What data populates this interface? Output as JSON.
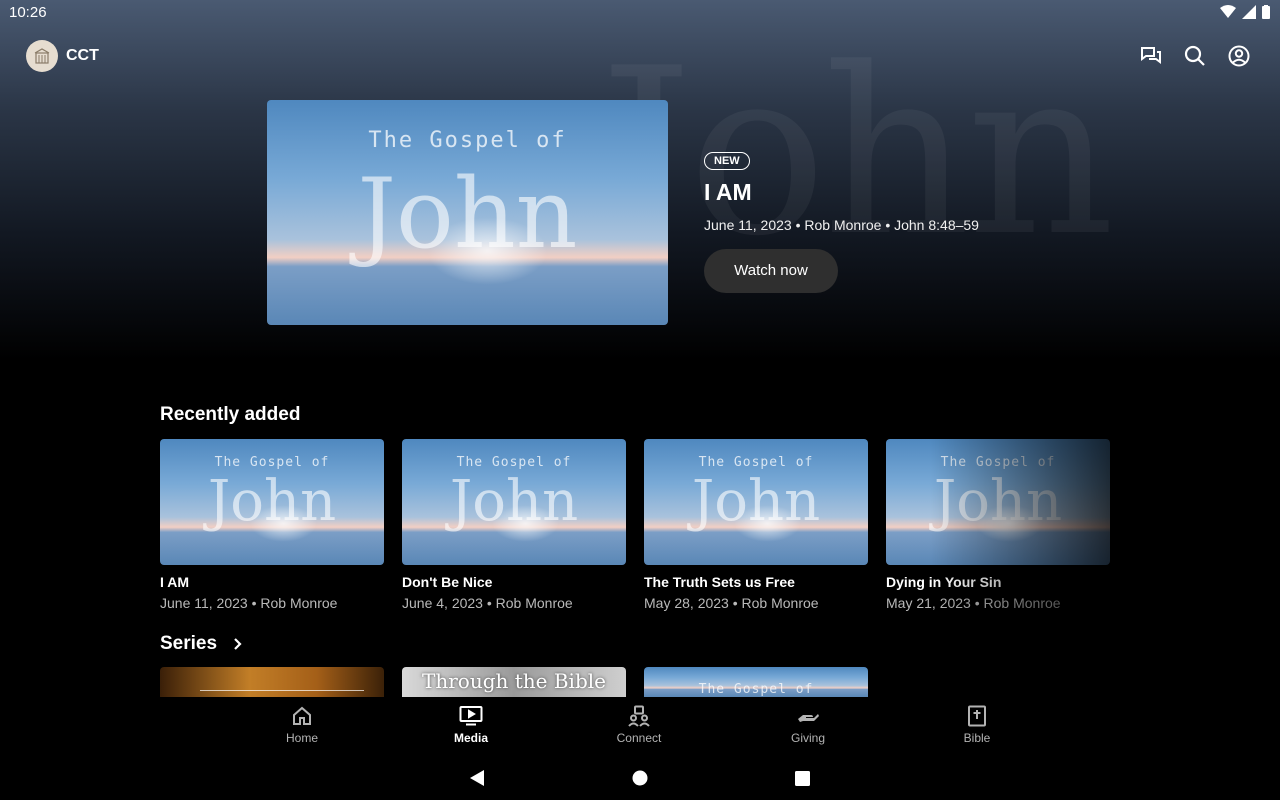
{
  "status": {
    "time": "10:26"
  },
  "app": {
    "name": "CCT"
  },
  "hero": {
    "badge": "NEW",
    "title": "I AM",
    "meta": "June 11, 2023 • Rob Monroe • John 8:48–59",
    "watch_label": "Watch now",
    "art_line1": "The Gospel of",
    "art_line2": "John"
  },
  "recent": {
    "title": "Recently added",
    "items": [
      {
        "title": "I AM",
        "meta": "June 11, 2023 • Rob Monroe",
        "art_line1": "The Gospel of",
        "art_line2": "John"
      },
      {
        "title": "Don't Be Nice",
        "meta": "June 4, 2023 • Rob Monroe",
        "art_line1": "The Gospel of",
        "art_line2": "John"
      },
      {
        "title": "The Truth Sets us Free",
        "meta": "May 28, 2023 • Rob Monroe",
        "art_line1": "The Gospel of",
        "art_line2": "John"
      },
      {
        "title": "Dying in Your Sin",
        "meta": "May 21, 2023 • Rob Monroe",
        "art_line1": "The Gospel of",
        "art_line2": "John"
      }
    ]
  },
  "series": {
    "title": "Series",
    "items": [
      {
        "label": ""
      },
      {
        "label": "Through the Bible"
      },
      {
        "label": "The Gospel of"
      }
    ]
  },
  "nav": {
    "items": [
      {
        "label": "Home",
        "icon": "home-icon"
      },
      {
        "label": "Media",
        "icon": "media-icon",
        "active": true
      },
      {
        "label": "Connect",
        "icon": "connect-icon"
      },
      {
        "label": "Giving",
        "icon": "giving-icon"
      },
      {
        "label": "Bible",
        "icon": "bible-icon"
      }
    ]
  },
  "colors": {
    "background": "#000000",
    "button": "#2f2f2f",
    "muted_text": "#b9b9b9"
  }
}
